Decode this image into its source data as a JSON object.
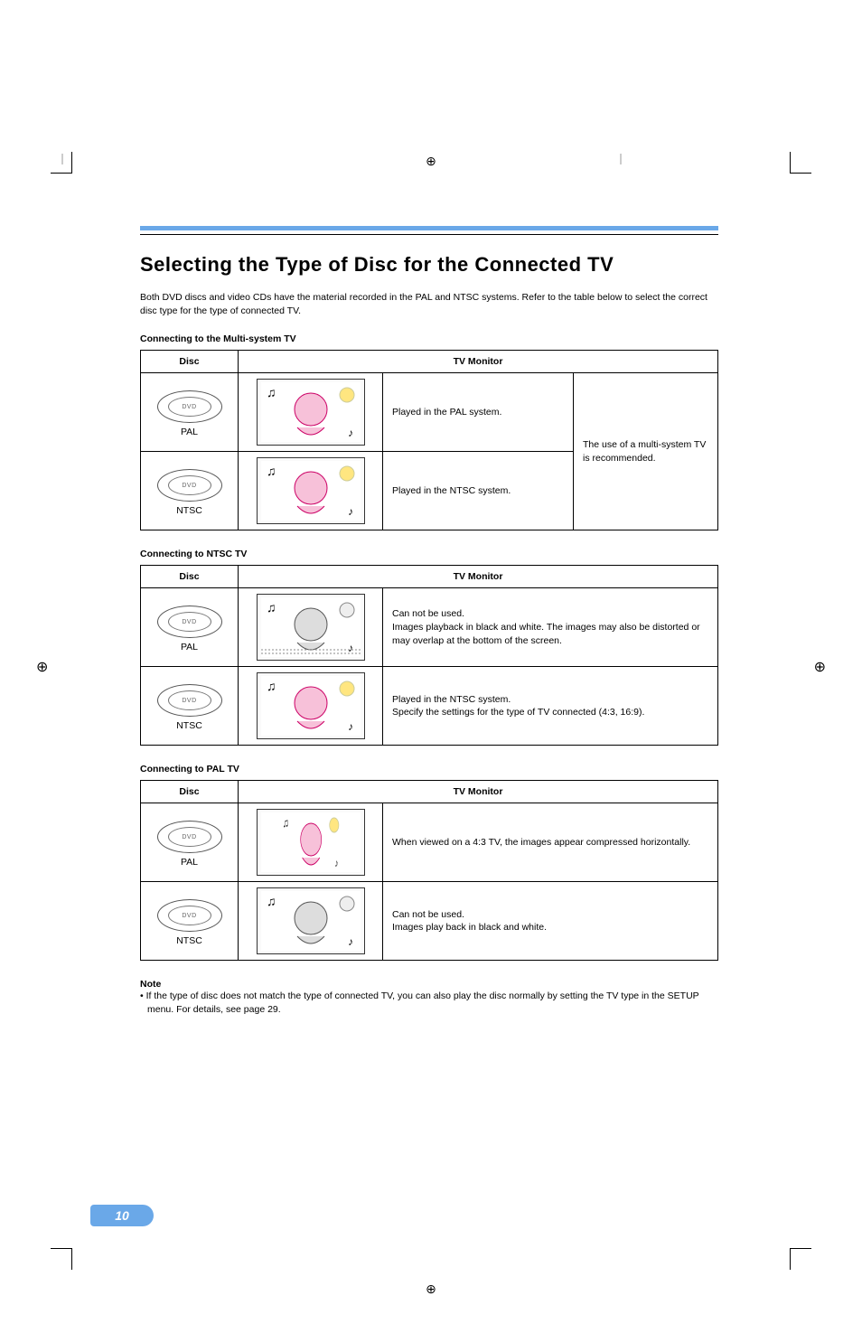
{
  "page_number": "10",
  "title": "Selecting the Type of Disc for the Connected TV",
  "intro": "Both DVD discs and video CDs have the material recorded in the PAL and NTSC systems. Refer to the table below to select the correct disc type for the type of connected TV.",
  "sections": {
    "multi": {
      "heading": "Connecting to the Multi-system TV",
      "col_disc": "Disc",
      "col_monitor": "TV Monitor",
      "row_pal_label": "PAL",
      "row_pal_text": "Played in the PAL system.",
      "row_ntsc_label": "NTSC",
      "row_ntsc_text": "Played in the NTSC system.",
      "recommend": "The use of a multi-system TV is recommended."
    },
    "ntsc": {
      "heading": "Connecting to NTSC TV",
      "col_disc": "Disc",
      "col_monitor": "TV Monitor",
      "row_pal_label": "PAL",
      "row_pal_text": "Can not be used.\nImages playback in black and white. The images may also be distorted or may overlap at the bottom of the screen.",
      "row_ntsc_label": "NTSC",
      "row_ntsc_text": "Played in the NTSC system.\nSpecify the settings for the type of TV connected (4:3, 16:9)."
    },
    "pal": {
      "heading": "Connecting to PAL TV",
      "col_disc": "Disc",
      "col_monitor": "TV Monitor",
      "row_pal_label": "PAL",
      "row_pal_text": "When viewed on a 4:3 TV, the images appear compressed horizontally.",
      "row_ntsc_label": "NTSC",
      "row_ntsc_text": "Can not be used.\nImages play back in black and white."
    }
  },
  "note": {
    "heading": "Note",
    "body": "• If the type of disc does not match the type of connected TV, you can also play the disc normally by setting the TV type in the SETUP menu. For details, see page 29."
  },
  "icons": {
    "disc_text": "DVD",
    "music_note": "♫",
    "registration": "⊕"
  },
  "colorbars": {
    "left": [
      "#000",
      "#000",
      "#000",
      "#333",
      "#666",
      "#999",
      "#bbb",
      "#ddd",
      "#fff"
    ],
    "right": [
      "#f0d000",
      "#e04040",
      "#d0d0d0",
      "#00b0e0",
      "#0060c0",
      "#b080c0",
      "#f090b0",
      "#f0f0f0",
      "#a0a0a0"
    ]
  }
}
